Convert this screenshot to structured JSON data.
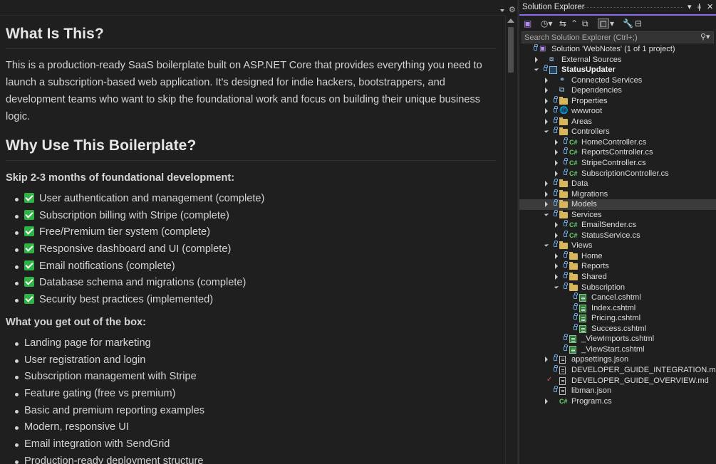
{
  "preview": {
    "sections": [
      {
        "heading": "What Is This?",
        "paragraph": "This is a production-ready SaaS boilerplate built on ASP.NET Core that provides everything you need to launch a subscription-based web application. It's designed for indie hackers, bootstrappers, and development teams who want to skip the foundational work and focus on building their unique business logic."
      },
      {
        "heading": "Why Use This Boilerplate?",
        "subheading": "Skip 2-3 months of foundational development:",
        "checklist": [
          "User authentication and management (complete)",
          "Subscription billing with Stripe (complete)",
          "Free/Premium tier system (complete)",
          "Responsive dashboard and UI (complete)",
          "Email notifications (complete)",
          "Database schema and migrations (complete)",
          "Security best practices (implemented)"
        ],
        "subheading2": "What you get out of the box:",
        "features": [
          "Landing page for marketing",
          "User registration and login",
          "Subscription management with Stripe",
          "Feature gating (free vs premium)",
          "Basic and premium reporting examples",
          "Modern, responsive UI",
          "Email integration with SendGrid",
          "Production-ready deployment structure"
        ]
      }
    ]
  },
  "solution_explorer": {
    "title": "Solution Explorer",
    "search_placeholder": "Search Solution Explorer (Ctrl+;)",
    "accent_color": "#8f6af0",
    "tree": [
      {
        "label": "Solution 'WebNotes' (1 of 1 project)",
        "icon": "solution-icon",
        "indent": 0,
        "twisty": "none",
        "lock": true
      },
      {
        "label": "External Sources",
        "icon": "external-sources-icon",
        "indent": 1,
        "twisty": "closed",
        "lock": false
      },
      {
        "label": "StatusUpdater",
        "icon": "project-icon",
        "indent": 1,
        "twisty": "open",
        "lock": true,
        "bold": true
      },
      {
        "label": "Connected Services",
        "icon": "connected-services-icon",
        "indent": 2,
        "twisty": "closed",
        "lock": false
      },
      {
        "label": "Dependencies",
        "icon": "dependencies-icon",
        "indent": 2,
        "twisty": "closed",
        "lock": false
      },
      {
        "label": "Properties",
        "icon": "properties-icon",
        "indent": 2,
        "twisty": "closed",
        "lock": true
      },
      {
        "label": "wwwroot",
        "icon": "globe-icon",
        "indent": 2,
        "twisty": "closed",
        "lock": true
      },
      {
        "label": "Areas",
        "icon": "folder-icon",
        "indent": 2,
        "twisty": "closed",
        "lock": true
      },
      {
        "label": "Controllers",
        "icon": "folder-icon",
        "indent": 2,
        "twisty": "open",
        "lock": true
      },
      {
        "label": "HomeController.cs",
        "icon": "csharp-file-icon",
        "indent": 3,
        "twisty": "closed",
        "lock": true
      },
      {
        "label": "ReportsController.cs",
        "icon": "csharp-file-icon",
        "indent": 3,
        "twisty": "closed",
        "lock": true
      },
      {
        "label": "StripeController.cs",
        "icon": "csharp-file-icon",
        "indent": 3,
        "twisty": "closed",
        "lock": true
      },
      {
        "label": "SubscriptionController.cs",
        "icon": "csharp-file-icon",
        "indent": 3,
        "twisty": "closed",
        "lock": true
      },
      {
        "label": "Data",
        "icon": "folder-icon",
        "indent": 2,
        "twisty": "closed",
        "lock": true
      },
      {
        "label": "Migrations",
        "icon": "folder-icon",
        "indent": 2,
        "twisty": "closed",
        "lock": true
      },
      {
        "label": "Models",
        "icon": "folder-icon",
        "indent": 2,
        "twisty": "closed",
        "lock": true,
        "selected": true
      },
      {
        "label": "Services",
        "icon": "folder-icon",
        "indent": 2,
        "twisty": "open",
        "lock": true
      },
      {
        "label": "EmailSender.cs",
        "icon": "csharp-file-icon",
        "indent": 3,
        "twisty": "closed",
        "lock": true
      },
      {
        "label": "StatusService.cs",
        "icon": "csharp-file-icon",
        "indent": 3,
        "twisty": "closed",
        "lock": true
      },
      {
        "label": "Views",
        "icon": "folder-icon",
        "indent": 2,
        "twisty": "open",
        "lock": true
      },
      {
        "label": "Home",
        "icon": "folder-icon",
        "indent": 3,
        "twisty": "closed",
        "lock": true
      },
      {
        "label": "Reports",
        "icon": "folder-icon",
        "indent": 3,
        "twisty": "closed",
        "lock": true
      },
      {
        "label": "Shared",
        "icon": "folder-icon",
        "indent": 3,
        "twisty": "closed",
        "lock": true
      },
      {
        "label": "Subscription",
        "icon": "folder-icon",
        "indent": 3,
        "twisty": "open",
        "lock": true
      },
      {
        "label": "Cancel.cshtml",
        "icon": "cshtml-file-icon",
        "indent": 4,
        "twisty": "none",
        "lock": true
      },
      {
        "label": "Index.cshtml",
        "icon": "cshtml-file-icon",
        "indent": 4,
        "twisty": "none",
        "lock": true
      },
      {
        "label": "Pricing.cshtml",
        "icon": "cshtml-file-icon",
        "indent": 4,
        "twisty": "none",
        "lock": true
      },
      {
        "label": "Success.cshtml",
        "icon": "cshtml-file-icon",
        "indent": 4,
        "twisty": "none",
        "lock": true
      },
      {
        "label": "_ViewImports.cshtml",
        "icon": "cshtml-file-icon",
        "indent": 3,
        "twisty": "none",
        "lock": true
      },
      {
        "label": "_ViewStart.cshtml",
        "icon": "cshtml-file-icon",
        "indent": 3,
        "twisty": "none",
        "lock": true
      },
      {
        "label": "appsettings.json",
        "icon": "json-file-icon",
        "indent": 2,
        "twisty": "closed",
        "lock": true
      },
      {
        "label": "DEVELOPER_GUIDE_INTEGRATION.md",
        "icon": "markdown-file-icon",
        "indent": 2,
        "twisty": "none",
        "lock": true
      },
      {
        "label": "DEVELOPER_GUIDE_OVERVIEW.md",
        "icon": "markdown-file-icon",
        "indent": 2,
        "twisty": "none",
        "lock": false,
        "modified": true
      },
      {
        "label": "libman.json",
        "icon": "json-file-icon",
        "indent": 2,
        "twisty": "none",
        "lock": true
      },
      {
        "label": "Program.cs",
        "icon": "csharp-file-icon",
        "indent": 2,
        "twisty": "closed",
        "lock": false
      }
    ]
  }
}
